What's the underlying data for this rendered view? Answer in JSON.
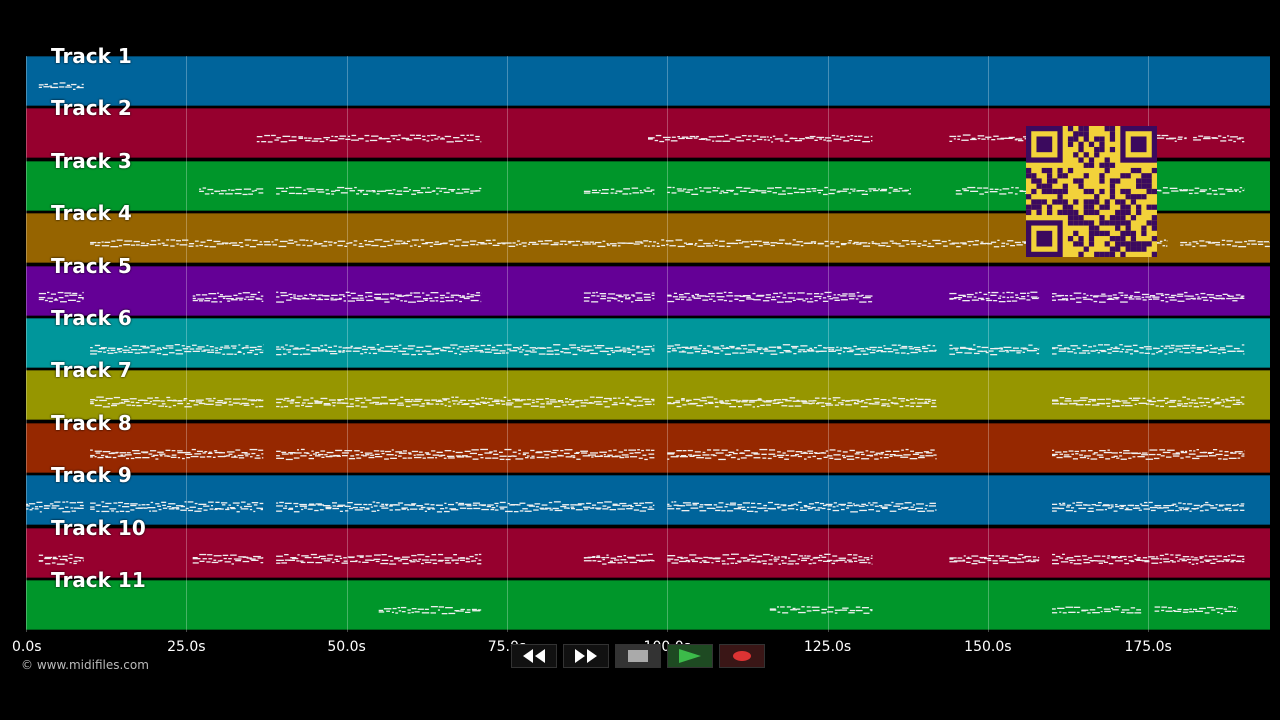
{
  "tracks": [
    {
      "label": "Track 1",
      "color": "#00649b"
    },
    {
      "label": "Track 2",
      "color": "#96002e"
    },
    {
      "label": "Track 3",
      "color": "#00962a"
    },
    {
      "label": "Track 4",
      "color": "#966400"
    },
    {
      "label": "Track 5",
      "color": "#640096"
    },
    {
      "label": "Track 6",
      "color": "#00969b"
    },
    {
      "label": "Track 7",
      "color": "#969600"
    },
    {
      "label": "Track 8",
      "color": "#962800"
    },
    {
      "label": "Track 9",
      "color": "#00649b"
    },
    {
      "label": "Track 10",
      "color": "#96002e"
    },
    {
      "label": "Track 11",
      "color": "#00962a"
    }
  ],
  "timeline": {
    "ticks": [
      "0.0s",
      "25.0s",
      "50.0s",
      "75.0s",
      "100.0s",
      "125.0s",
      "150.0s",
      "175.0s"
    ],
    "tick_seconds": [
      0,
      25,
      50,
      75,
      100,
      125,
      150,
      175
    ],
    "max_seconds": 194
  },
  "note_segments": [
    [
      [
        2,
        9
      ]
    ],
    [
      [
        36,
        71
      ],
      [
        97,
        132
      ],
      [
        144,
        181
      ],
      [
        182,
        190
      ]
    ],
    [
      [
        27,
        37
      ],
      [
        39,
        71
      ],
      [
        87,
        98
      ],
      [
        100,
        138
      ],
      [
        145,
        190
      ]
    ],
    [
      [
        10,
        178
      ],
      [
        180,
        194
      ]
    ],
    [
      [
        2,
        9
      ],
      [
        26,
        37
      ],
      [
        39,
        71
      ],
      [
        87,
        98
      ],
      [
        100,
        132
      ],
      [
        144,
        158
      ],
      [
        160,
        190
      ]
    ],
    [
      [
        10,
        37
      ],
      [
        39,
        98
      ],
      [
        100,
        142
      ],
      [
        144,
        158
      ],
      [
        160,
        190
      ]
    ],
    [
      [
        10,
        37
      ],
      [
        39,
        98
      ],
      [
        100,
        142
      ],
      [
        160,
        190
      ]
    ],
    [
      [
        10,
        37
      ],
      [
        39,
        98
      ],
      [
        100,
        142
      ],
      [
        160,
        190
      ]
    ],
    [
      [
        0,
        9
      ],
      [
        10,
        37
      ],
      [
        39,
        98
      ],
      [
        100,
        142
      ],
      [
        160,
        190
      ]
    ],
    [
      [
        2,
        9
      ],
      [
        26,
        37
      ],
      [
        39,
        71
      ],
      [
        87,
        98
      ],
      [
        100,
        132
      ],
      [
        144,
        158
      ],
      [
        160,
        190
      ]
    ],
    [
      [
        55,
        71
      ],
      [
        116,
        132
      ],
      [
        160,
        174
      ],
      [
        176,
        189
      ]
    ]
  ],
  "copyright": "© www.midifiles.com",
  "controls": {
    "rewind_icon": "double-left-arrow-icon",
    "forward_icon": "double-right-arrow-icon",
    "stop_icon": "stop-square-icon",
    "play_icon": "play-triangle-icon",
    "record_icon": "record-circle-icon",
    "play_color": "#2a9a3a",
    "record_color": "#dd3333"
  },
  "qr_code": {
    "color_bg": "#f2d23a",
    "color_fg": "#3b0a5e"
  }
}
